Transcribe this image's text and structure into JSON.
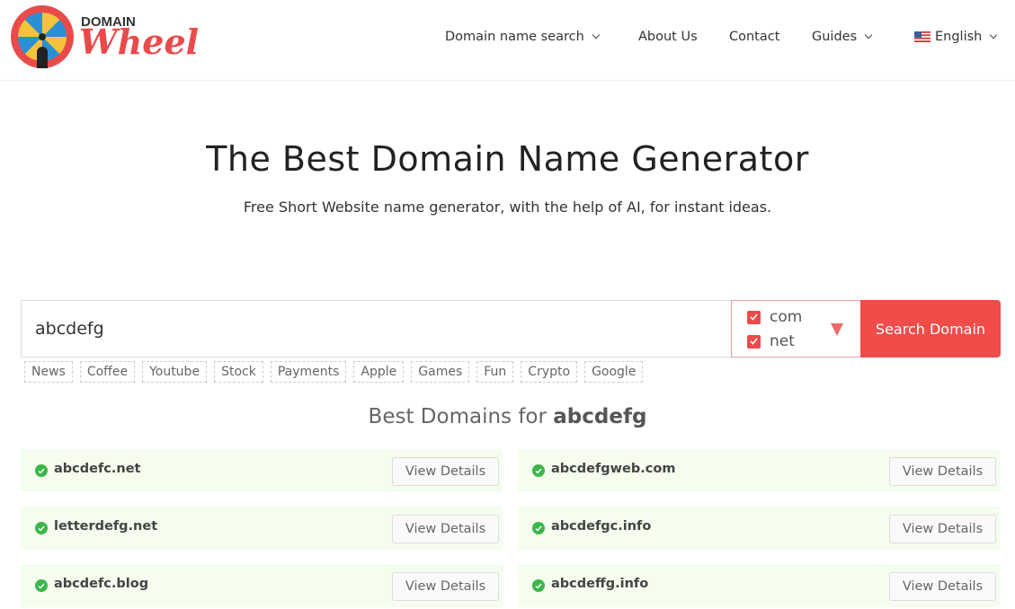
{
  "brand": {
    "line1": "DOMAIN",
    "line2": "Wheel"
  },
  "nav": [
    {
      "label": "Domain name search",
      "dropdown": true
    },
    {
      "label": "About Us"
    },
    {
      "label": "Contact"
    },
    {
      "label": "Guides",
      "dropdown": true
    },
    {
      "label": "English",
      "dropdown": true,
      "icon": "us-flag-icon"
    }
  ],
  "hero": {
    "title": "The Best Domain Name Generator",
    "subtitle": "Free Short Website name generator, with the help of AI, for instant ideas."
  },
  "search": {
    "value": "abcdefg",
    "extensions": [
      {
        "label": "com",
        "checked": true
      },
      {
        "label": "net",
        "checked": true
      }
    ],
    "button": "Search Domain"
  },
  "tags": [
    "News",
    "Coffee",
    "Youtube",
    "Stock",
    "Payments",
    "Apple",
    "Games",
    "Fun",
    "Crypto",
    "Google"
  ],
  "results": {
    "heading_prefix": "Best Domains for",
    "keyword": "abcdefg",
    "button": "View Details",
    "items": [
      "abcdefc.net",
      "abcdefgweb.com",
      "letterdefg.net",
      "abcdefgc.info",
      "abcdefc.blog",
      "abcdeffg.info"
    ]
  },
  "colors": {
    "accent": "#ef4c4a",
    "available": "#3cb64a",
    "card_bg": "#f5fdee"
  }
}
